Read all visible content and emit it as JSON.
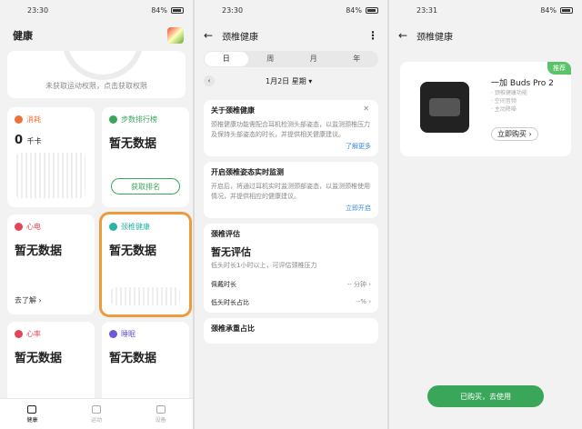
{
  "screen1": {
    "time": "23:30",
    "battery": "84%",
    "title": "健康",
    "permission_text": "未获取运动权限，点击获取权限",
    "tiles": [
      {
        "title": "消耗",
        "value": "0",
        "unit": "千卡",
        "color": "#f0703a"
      },
      {
        "title": "步数排行榜",
        "value": "暂无数据",
        "button": "获取排名",
        "color": "#3aa65a"
      },
      {
        "title": "心电",
        "value": "暂无数据",
        "link": "去了解",
        "color": "#e0485a"
      },
      {
        "title": "颈椎健康",
        "value": "暂无数据",
        "color": "#2bb3a7"
      },
      {
        "title": "心率",
        "value": "暂无数据",
        "color": "#e0485a"
      },
      {
        "title": "睡眠",
        "value": "暂无数据",
        "color": "#6b5bd6"
      }
    ],
    "tabs": [
      "健康",
      "运动",
      "设备"
    ]
  },
  "screen2": {
    "time": "23:30",
    "battery": "84%",
    "title": "颈椎健康",
    "segments": [
      "日",
      "周",
      "月",
      "年"
    ],
    "date": "1月2日 星期",
    "about": {
      "title": "关于颈椎健康",
      "text": "颈椎健康功能需配合耳机检测头部姿态，以监测颈椎压力及保持头部姿态的时长，并提供相关健康建议。",
      "more": "了解更多"
    },
    "realtime": {
      "title": "开启颈椎姿态实时监测",
      "text": "开启后，将通过耳机实时监测颈部姿态，以监测颈椎使用情况，并提供相应的健康建议。",
      "action": "立即开启"
    },
    "eval": {
      "title": "颈椎评估",
      "status": "暂无评估",
      "desc": "低头时长1小时以上，可评估颈椎压力",
      "rows": [
        {
          "label": "佩戴时长",
          "value": "-- 分钟"
        },
        {
          "label": "低头时长占比",
          "value": "--%"
        }
      ]
    },
    "bottom": "颈椎承重占比"
  },
  "screen3": {
    "time": "23:31",
    "battery": "84%",
    "title": "颈椎健康",
    "badge": "推荐",
    "product_name": "一加 Buds Pro 2",
    "features": [
      "· 颈椎健康功能",
      "· 空间音频",
      "· 主动降噪"
    ],
    "buy": "立即购买",
    "cta": "已购买，去使用"
  }
}
